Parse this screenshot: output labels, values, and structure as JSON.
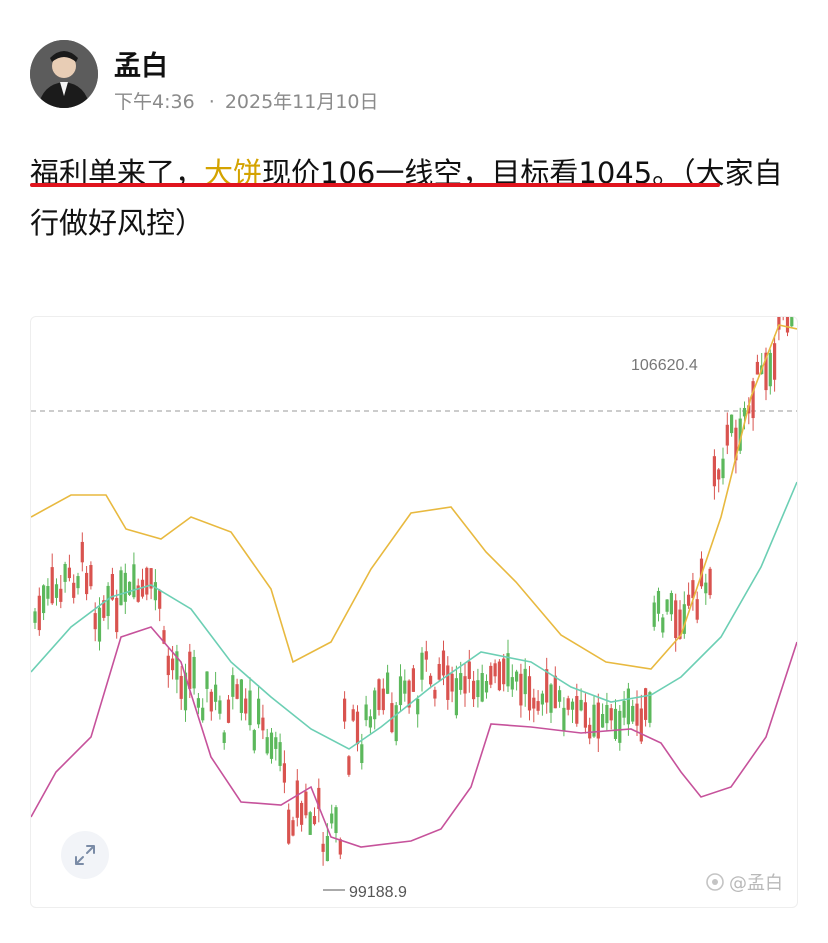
{
  "author": {
    "name": "孟白",
    "time": "下午4:36",
    "date": "2025年11月10日",
    "separator": "·"
  },
  "post": {
    "part1": "福利单来了，",
    "highlight": "大饼",
    "part2": "现价106一线空，目标看1045。（大家自行做好风控）"
  },
  "chart": {
    "high_label": "106620.4",
    "low_label": "99188.9",
    "watermark": "@孟白",
    "colors": {
      "upper_band": "#e8b93f",
      "middle_band": "#6ccfb4",
      "lower_band": "#c6529b",
      "up_candle": "#5cb85c",
      "down_candle": "#d9534f"
    },
    "icons": {
      "expand": "expand-icon",
      "watermark_logo": "toutiao-logo"
    }
  },
  "chart_data": {
    "type": "candlestick",
    "series": [
      {
        "name": "",
        "values": []
      }
    ],
    "price_labels": [
      "106620.4",
      "99188.9"
    ]
  }
}
